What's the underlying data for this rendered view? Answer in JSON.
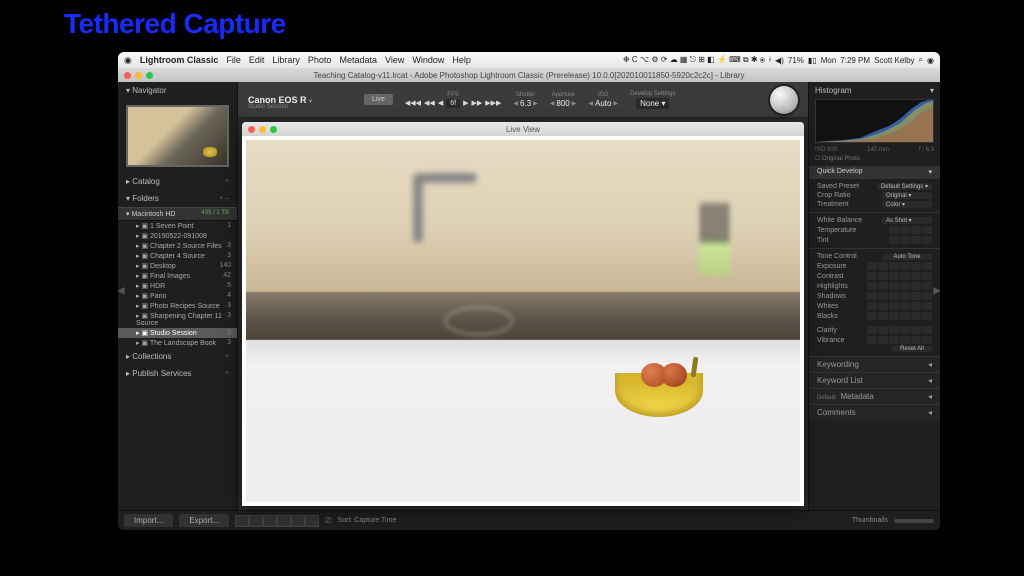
{
  "slide": {
    "title": "Tethered Capture"
  },
  "menubar": {
    "app": "Lightroom Classic",
    "items": [
      "File",
      "Edit",
      "Library",
      "Photo",
      "Metadata",
      "View",
      "Window",
      "Help"
    ],
    "right": {
      "battery": "71%",
      "day": "Mon",
      "time": "7:29 PM",
      "user": "Scott Kelby"
    }
  },
  "titlebar": {
    "text": "Teaching Catalog-v11.lrcat - Adobe Photoshop Lightroom Classic (Prerelease) 10.0.0[202010011850-5920c2c2c] - Library"
  },
  "left": {
    "navigator": "Navigator",
    "catalog": "Catalog",
    "folders": "Folders",
    "volume": {
      "name": "Macintosh HD",
      "space": "435 / 1 TB"
    },
    "items": [
      {
        "name": "1 Seven Point",
        "count": "1"
      },
      {
        "name": "20190522-091008",
        "count": ""
      },
      {
        "name": "Chapter 2 Source Files",
        "count": "3"
      },
      {
        "name": "Chapter 4 Source",
        "count": "3"
      },
      {
        "name": "Desktop",
        "count": "140"
      },
      {
        "name": "Final Images",
        "count": "42"
      },
      {
        "name": "HDR",
        "count": "5"
      },
      {
        "name": "Pano",
        "count": "4"
      },
      {
        "name": "Photo Recipes Source",
        "count": "3"
      },
      {
        "name": "Sharpening Chapter 11 Source",
        "count": "3"
      },
      {
        "name": "Studio Session",
        "count": "3",
        "sel": true
      },
      {
        "name": "The Landscape Book",
        "count": "3"
      }
    ],
    "collections": "Collections",
    "publish": "Publish Services"
  },
  "tether": {
    "camera": "Canon EOS R",
    "session": "Studio Session",
    "live": "Live",
    "fps": {
      "lbl": "FPS",
      "val": "6f"
    },
    "shutter": {
      "lbl": "Shutter",
      "val": "6.3"
    },
    "aperture": {
      "lbl": "Aperture",
      "val": "800"
    },
    "iso": {
      "lbl": "ISO",
      "val": "Auto"
    },
    "dev": {
      "lbl": "Develop Settings",
      "val": "None"
    }
  },
  "live_window": {
    "title": "Live View"
  },
  "right": {
    "histogram": "Histogram",
    "histo_labels": [
      "ISO 800",
      "140 mm",
      "f / 6.3"
    ],
    "orig_photo": "Original Photo",
    "quick_develop": "Quick Develop",
    "saved_preset": {
      "lbl": "Saved Preset",
      "val": "Default Settings"
    },
    "crop": {
      "lbl": "Crop Ratio",
      "val": "Original"
    },
    "treatment": {
      "lbl": "Treatment",
      "val": "Color"
    },
    "wb": {
      "lbl": "White Balance",
      "val": "As Shot"
    },
    "temperature": "Temperature",
    "tint": "Tint",
    "tone": "Tone Control",
    "auto_tone": "Auto Tone",
    "exposure": "Exposure",
    "contrast": "Contrast",
    "highlights": "Highlights",
    "shadows": "Shadows",
    "whites": "Whites",
    "blacks": "Blacks",
    "clarity": "Clarity",
    "vibrance": "Vibrance",
    "reset": "Reset All",
    "keywording": "Keywording",
    "keyword_list": "Keyword List",
    "metadata": "Metadata",
    "metadata_preset": "Default",
    "comments": "Comments"
  },
  "bottom": {
    "import": "Import...",
    "export": "Export...",
    "sort_lbl": "Sort:",
    "sort_val": "Capture Time",
    "thumbnails": "Thumbnails"
  }
}
